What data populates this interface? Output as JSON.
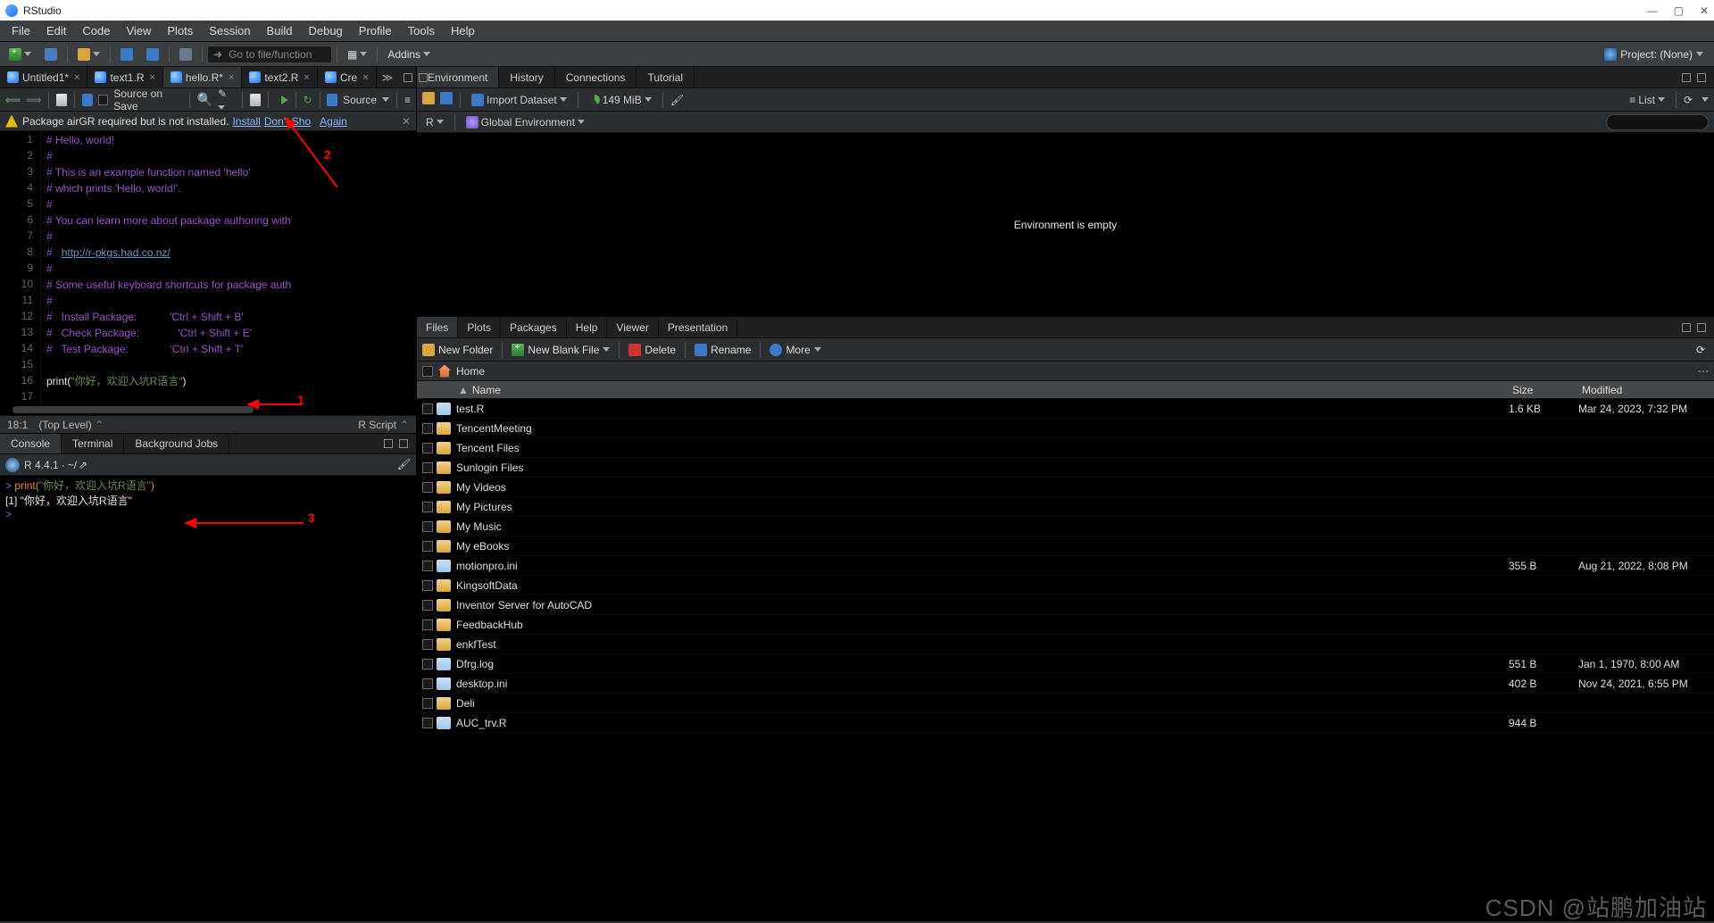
{
  "title": "RStudio",
  "menus": [
    "File",
    "Edit",
    "Code",
    "View",
    "Plots",
    "Session",
    "Build",
    "Debug",
    "Profile",
    "Tools",
    "Help"
  ],
  "toolbar": {
    "goto_placeholder": "Go to file/function",
    "addins": "Addins",
    "project": "Project: (None)"
  },
  "editor": {
    "tabs": [
      {
        "name": "Untitled1*",
        "active": false
      },
      {
        "name": "text1.R",
        "active": false
      },
      {
        "name": "hello.R*",
        "active": true
      },
      {
        "name": "text2.R",
        "active": false
      },
      {
        "name": "Cre",
        "active": false
      }
    ],
    "source_on_save": "Source on Save",
    "run": "Run",
    "source_btn": "Source",
    "warning": {
      "text": "Package airGR required but is not installed.",
      "install": "Install",
      "dont_show": "Don't Sho",
      "again": "Again"
    },
    "code_lines": [
      {
        "n": 1,
        "type": "comment",
        "text": "# Hello, world!"
      },
      {
        "n": 2,
        "type": "comment",
        "text": "#"
      },
      {
        "n": 3,
        "type": "comment",
        "text": "# This is an example function named 'hello'"
      },
      {
        "n": 4,
        "type": "comment",
        "text": "# which prints 'Hello, world!'."
      },
      {
        "n": 5,
        "type": "comment",
        "text": "#"
      },
      {
        "n": 6,
        "type": "comment",
        "text": "# You can learn more about package authoring with"
      },
      {
        "n": 7,
        "type": "comment",
        "text": "#"
      },
      {
        "n": 8,
        "type": "link",
        "prefix": "#   ",
        "text": "http://r-pkgs.had.co.nz/"
      },
      {
        "n": 9,
        "type": "comment",
        "text": "#"
      },
      {
        "n": 10,
        "type": "comment",
        "text": "# Some useful keyboard shortcuts for package auth"
      },
      {
        "n": 11,
        "type": "comment",
        "text": "#"
      },
      {
        "n": 12,
        "type": "comment",
        "text": "#   Install Package:           'Ctrl + Shift + B'"
      },
      {
        "n": 13,
        "type": "comment",
        "text": "#   Check Package:             'Ctrl + Shift + E'"
      },
      {
        "n": 14,
        "type": "comment",
        "text": "#   Test Package:              'Ctrl + Shift + T'"
      },
      {
        "n": 15,
        "type": "blank",
        "text": ""
      },
      {
        "n": 16,
        "type": "print",
        "func": "print",
        "str": "\"你好，欢迎入坑R语言\""
      },
      {
        "n": 17,
        "type": "blank",
        "text": ""
      }
    ],
    "status": {
      "pos": "18:1",
      "scope": "(Top Level)",
      "lang": "R Script"
    }
  },
  "console": {
    "tabs": [
      "Console",
      "Terminal",
      "Background Jobs"
    ],
    "version": "R 4.4.1",
    "cwd": "~/",
    "lines": [
      {
        "kind": "in",
        "text": "print(\"你好，欢迎入坑R语言\")"
      },
      {
        "kind": "out",
        "text": "[1] \"你好，欢迎入坑R语言\""
      },
      {
        "kind": "prompt",
        "text": ""
      }
    ]
  },
  "env": {
    "tabs": [
      "Environment",
      "History",
      "Connections",
      "Tutorial"
    ],
    "import": "Import Dataset",
    "mem": "149 MiB",
    "list": "List",
    "scope": "R",
    "global": "Global Environment",
    "empty": "Environment is empty"
  },
  "files": {
    "tabs": [
      "Files",
      "Plots",
      "Packages",
      "Help",
      "Viewer",
      "Presentation"
    ],
    "toolbar": {
      "new_folder": "New Folder",
      "new_file": "New Blank File",
      "delete": "Delete",
      "rename": "Rename",
      "more": "More"
    },
    "breadcrumb": "Home",
    "cols": {
      "name": "Name",
      "size": "Size",
      "mod": "Modified"
    },
    "rows": [
      {
        "icon": "file",
        "name": "test.R",
        "size": "1.6 KB",
        "mod": "Mar 24, 2023, 7:32 PM"
      },
      {
        "icon": "folder",
        "name": "TencentMeeting",
        "size": "",
        "mod": ""
      },
      {
        "icon": "folder",
        "name": "Tencent Files",
        "size": "",
        "mod": ""
      },
      {
        "icon": "folder",
        "name": "Sunlogin Files",
        "size": "",
        "mod": ""
      },
      {
        "icon": "folder",
        "name": "My Videos",
        "size": "",
        "mod": ""
      },
      {
        "icon": "folder",
        "name": "My Pictures",
        "size": "",
        "mod": ""
      },
      {
        "icon": "folder",
        "name": "My Music",
        "size": "",
        "mod": ""
      },
      {
        "icon": "folder",
        "name": "My eBooks",
        "size": "",
        "mod": ""
      },
      {
        "icon": "file",
        "name": "motionpro.ini",
        "size": "355 B",
        "mod": "Aug 21, 2022, 8:08 PM"
      },
      {
        "icon": "folder",
        "name": "KingsoftData",
        "size": "",
        "mod": ""
      },
      {
        "icon": "folder",
        "name": "Inventor Server for AutoCAD",
        "size": "",
        "mod": ""
      },
      {
        "icon": "folder",
        "name": "FeedbackHub",
        "size": "",
        "mod": ""
      },
      {
        "icon": "folder",
        "name": "enkfTest",
        "size": "",
        "mod": ""
      },
      {
        "icon": "file",
        "name": "Dfrg.log",
        "size": "551 B",
        "mod": "Jan 1, 1970, 8:00 AM"
      },
      {
        "icon": "file",
        "name": "desktop.ini",
        "size": "402 B",
        "mod": "Nov 24, 2021, 6:55 PM"
      },
      {
        "icon": "folder",
        "name": "Deli",
        "size": "",
        "mod": ""
      },
      {
        "icon": "file",
        "name": "AUC_trv.R",
        "size": "944 B",
        "mod": ""
      }
    ]
  },
  "annotations": {
    "a1": "1",
    "a2": "2",
    "a3": "3"
  },
  "watermark": "CSDN @站鹏加油站"
}
